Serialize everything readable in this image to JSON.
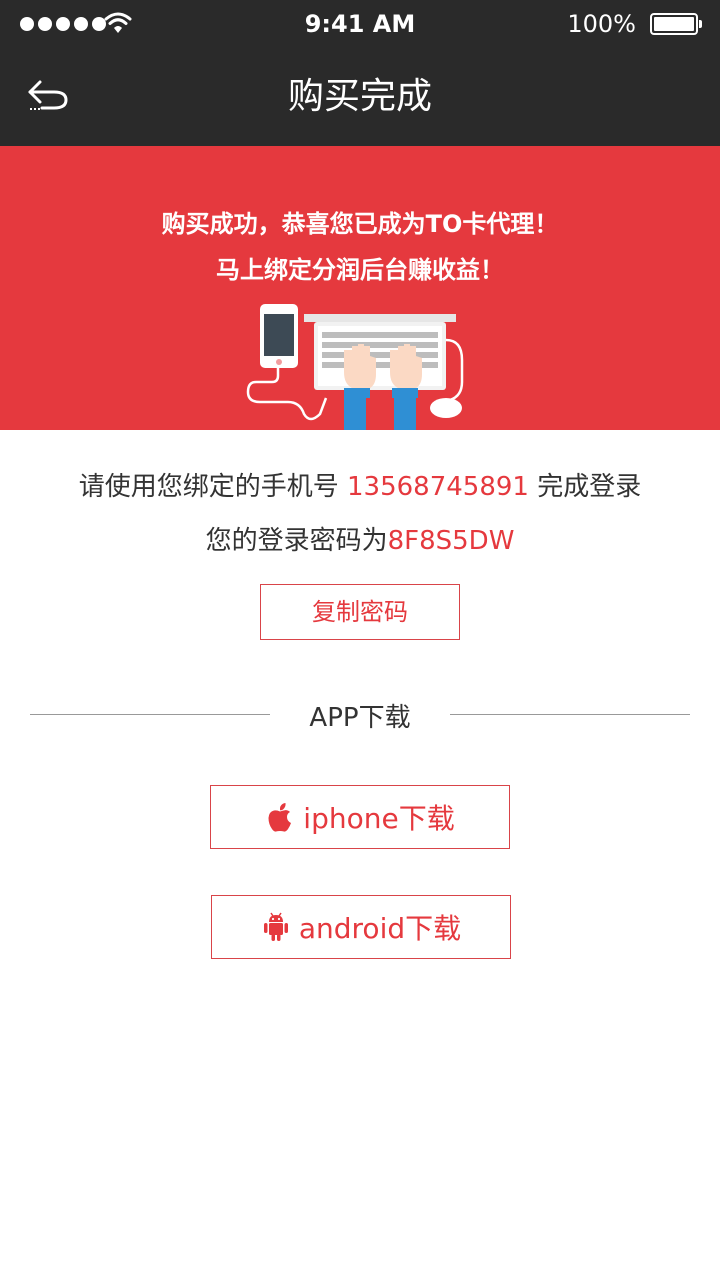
{
  "status_bar": {
    "time": "9:41 AM",
    "battery": "100%"
  },
  "nav": {
    "title": "购买完成"
  },
  "banner": {
    "line1": "购买成功，恭喜您已成为TO卡代理！",
    "line2": "马上绑定分润后台赚收益！"
  },
  "info": {
    "phone_prefix": "请使用您绑定的手机号 ",
    "phone": "13568745891",
    "phone_suffix": " 完成登录",
    "password_prefix": "您的登录密码为",
    "password": "8F8S5DW"
  },
  "copy_button": {
    "label": "复制密码"
  },
  "download": {
    "title": "APP下载",
    "iphone_label": "iphone下载",
    "android_label": "android下载"
  },
  "colors": {
    "accent": "#e5393e",
    "bar": "#2a2a2a"
  },
  "icons": {
    "back": "back-arrow-icon",
    "apple": "apple-icon",
    "android": "android-icon"
  }
}
